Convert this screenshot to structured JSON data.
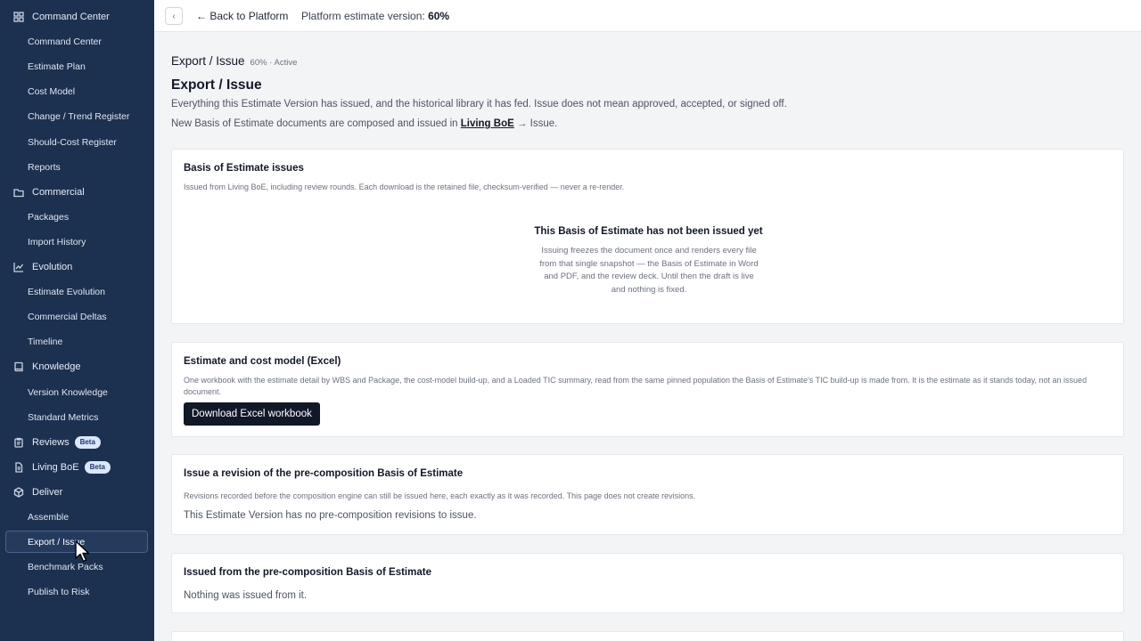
{
  "sidebar": {
    "rows": [
      {
        "label": "Command Center",
        "kind": "group",
        "icon": "grid-icon"
      },
      {
        "label": "Command Center",
        "kind": "child"
      },
      {
        "label": "Estimate Plan",
        "kind": "child"
      },
      {
        "label": "Cost Model",
        "kind": "child"
      },
      {
        "label": "Change / Trend Register",
        "kind": "child"
      },
      {
        "label": "Should-Cost Register",
        "kind": "child"
      },
      {
        "label": "Reports",
        "kind": "child"
      },
      {
        "label": "Commercial",
        "kind": "group",
        "icon": "folder-icon"
      },
      {
        "label": "Packages",
        "kind": "child"
      },
      {
        "label": "Import History",
        "kind": "child"
      },
      {
        "label": "Evolution",
        "kind": "group",
        "icon": "trend-chart-icon"
      },
      {
        "label": "Estimate Evolution",
        "kind": "child"
      },
      {
        "label": "Commercial Deltas",
        "kind": "child"
      },
      {
        "label": "Timeline",
        "kind": "child"
      },
      {
        "label": "Knowledge",
        "kind": "group",
        "icon": "book-icon"
      },
      {
        "label": "Version Knowledge",
        "kind": "child"
      },
      {
        "label": "Standard Metrics",
        "kind": "child"
      },
      {
        "label": "Reviews",
        "kind": "group",
        "icon": "clipboard-icon",
        "badge": "Beta"
      },
      {
        "label": "Living BoE",
        "kind": "group",
        "icon": "document-icon",
        "badge": "Beta"
      },
      {
        "label": "Deliver",
        "kind": "group",
        "icon": "package-icon"
      },
      {
        "label": "Assemble",
        "kind": "child"
      },
      {
        "label": "Export / Issue",
        "kind": "child",
        "active": true
      },
      {
        "label": "Benchmark Packs",
        "kind": "child"
      },
      {
        "label": "Publish to Risk",
        "kind": "child"
      }
    ]
  },
  "topbar": {
    "collapse_icon": "chevron-left-icon",
    "back_label": "← Back to Platform",
    "version_label": "Platform estimate version: ",
    "version_value": "60%"
  },
  "page": {
    "crumb_title": "Export / Issue",
    "crumb_meta": "60% · Active",
    "heading": "Export / Issue",
    "intro1": "Everything this Estimate Version has issued, and the historical library it has fed. Issue does not mean approved, accepted, or signed off.",
    "intro2_pre": "New Basis of Estimate documents are composed and issued in ",
    "intro2_link": "Living BoE",
    "intro2_post": " → Issue."
  },
  "cards": {
    "boe_issues": {
      "title": "Basis of Estimate issues",
      "subtitle": "Issued from Living BoE, including review rounds. Each download is the retained file, checksum-verified — never a re-render.",
      "empty_title": "This Basis of Estimate has not been issued yet",
      "empty_text": "Issuing freezes the document once and renders every file from that single snapshot — the Basis of Estimate in Word and PDF, and the review deck. Until then the draft is live and nothing is fixed."
    },
    "excel": {
      "title": "Estimate and cost model (Excel)",
      "subtitle": "One workbook with the estimate detail by WBS and Package, the cost-model build-up, and a Loaded TIC summary, read from the same pinned population the Basis of Estimate's TIC build-up is made from. It is the estimate as it stands today, not an issued document.",
      "button": "Download Excel workbook"
    },
    "revision": {
      "title": "Issue a revision of the pre-composition Basis of Estimate",
      "subtitle": "Revisions recorded before the composition engine can still be issued here, each exactly as it was recorded. This page does not create revisions.",
      "body": "This Estimate Version has no pre-composition revisions to issue."
    },
    "issued": {
      "title": "Issued from the pre-composition Basis of Estimate",
      "body": "Nothing was issued from it."
    }
  }
}
